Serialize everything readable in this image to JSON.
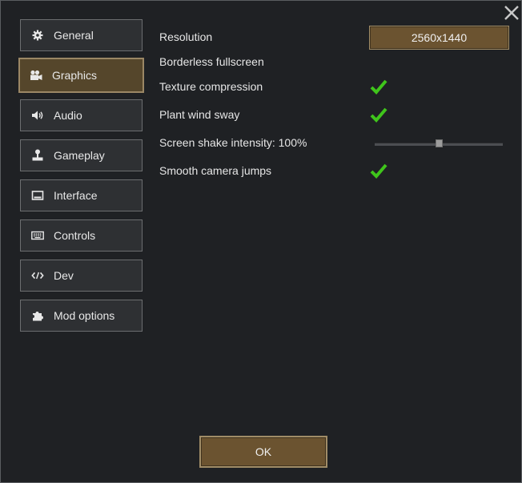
{
  "nav": {
    "items": [
      {
        "label": "General",
        "icon": "gear-icon"
      },
      {
        "label": "Graphics",
        "icon": "camera-icon",
        "selected": true
      },
      {
        "label": "Audio",
        "icon": "speaker-icon"
      },
      {
        "label": "Gameplay",
        "icon": "joystick-icon"
      },
      {
        "label": "Interface",
        "icon": "monitor-icon"
      },
      {
        "label": "Controls",
        "icon": "keyboard-icon"
      },
      {
        "label": "Dev",
        "icon": "code-icon"
      },
      {
        "label": "Mod options",
        "icon": "puzzle-icon"
      }
    ]
  },
  "graphics": {
    "resolution_label": "Resolution",
    "resolution_value": "2560x1440",
    "borderless_label": "Borderless fullscreen",
    "texture_label": "Texture compression",
    "texture_checked": true,
    "plant_label": "Plant wind sway",
    "plant_checked": true,
    "shake_label": "Screen shake intensity: 100%",
    "shake_value": 0.5,
    "smooth_label": "Smooth camera jumps",
    "smooth_checked": true
  },
  "footer": {
    "ok_label": "OK"
  },
  "colors": {
    "accent": "#6b5330",
    "selected_bg": "#55462b",
    "check_green": "#3fc51b",
    "panel_bg": "#1f2124"
  }
}
